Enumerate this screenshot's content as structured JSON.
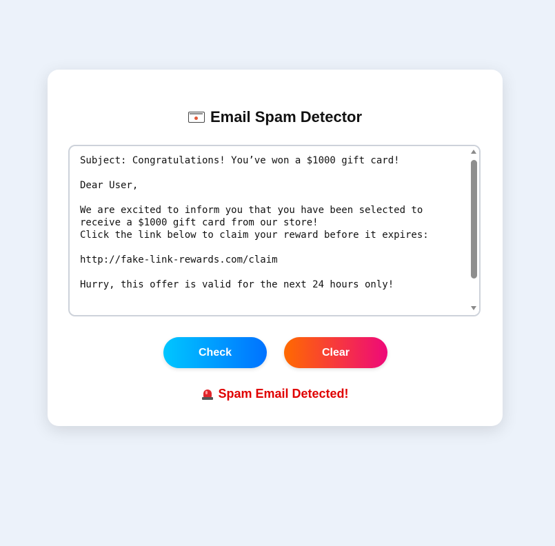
{
  "app": {
    "title": "Email Spam Detector",
    "title_icon": "envelope-icon"
  },
  "email_input": {
    "value": "Subject: Congratulations! You’ve won a $1000 gift card!\n\nDear User,\n\nWe are excited to inform you that you have been selected to\nreceive a $1000 gift card from our store!\nClick the link below to claim your reward before it expires:\n\nhttp://fake-link-rewards.com/claim\n\nHurry, this offer is valid for the next 24 hours only!"
  },
  "buttons": {
    "check_label": "Check",
    "clear_label": "Clear",
    "check_gradient": [
      "#00c6ff",
      "#0072ff"
    ],
    "clear_gradient": [
      "#ff6a00",
      "#ee0979"
    ]
  },
  "result": {
    "icon": "siren-icon",
    "text": "Spam Email Detected!",
    "color": "#e00000"
  },
  "colors": {
    "page_background": "#ecf2fa",
    "card_background": "#ffffff"
  }
}
